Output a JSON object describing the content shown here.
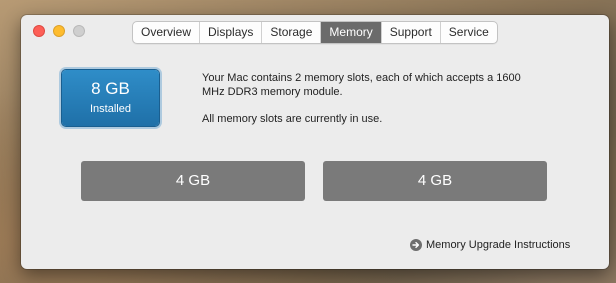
{
  "window": {
    "tabs": [
      {
        "label": "Overview",
        "active": false
      },
      {
        "label": "Displays",
        "active": false
      },
      {
        "label": "Storage",
        "active": false
      },
      {
        "label": "Memory",
        "active": true
      },
      {
        "label": "Support",
        "active": false
      },
      {
        "label": "Service",
        "active": false
      }
    ]
  },
  "memory": {
    "installed_size": "8 GB",
    "installed_label": "Installed",
    "description": "Your Mac contains 2 memory slots, each of which accepts a 1600 MHz DDR3 memory module.",
    "status": "All memory slots are currently in use.",
    "slots": [
      {
        "label": "4 GB"
      },
      {
        "label": "4 GB"
      }
    ],
    "upgrade_link": "Memory Upgrade Instructions",
    "upgrade_icon": "arrow-circle-right-icon"
  },
  "colors": {
    "accent": "#2a82bf",
    "tab_active": "#6b6b6b",
    "slot": "#7a7a7a",
    "close": "#fd5f57",
    "minimize": "#febc2e",
    "zoom_inactive": "#cfcfcf"
  }
}
